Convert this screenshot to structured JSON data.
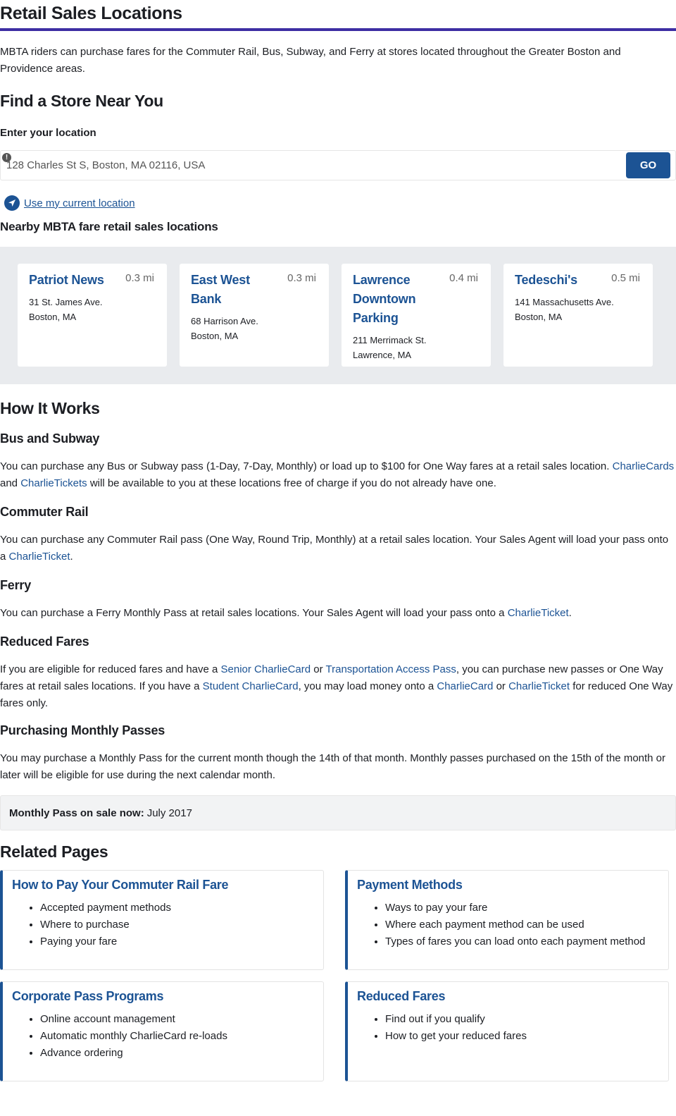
{
  "page": {
    "title": "Retail Sales Locations",
    "intro": "MBTA riders can purchase fares for the Commuter Rail, Bus, Subway, and Ferry at stores located throughout the Greater Boston and Providence areas."
  },
  "finder": {
    "title": "Find a Store Near You",
    "label": "Enter your location",
    "input_value": "128 Charles St S, Boston, MA 02116, USA",
    "go_label": "GO",
    "use_location_label": "Use my current location",
    "nearby_label": "Nearby MBTA fare retail sales locations"
  },
  "stores": [
    {
      "name": "Patriot News",
      "distance": "0.3 mi",
      "street": "31 St. James Ave.",
      "city": "Boston, MA"
    },
    {
      "name": "East West Bank",
      "distance": "0.3 mi",
      "street": "68 Harrison Ave.",
      "city": "Boston, MA"
    },
    {
      "name": "Lawrence Downtown Parking",
      "distance": "0.4 mi",
      "street": "211 Merrimack St.",
      "city": "Lawrence, MA"
    },
    {
      "name": "Tedeschi's",
      "distance": "0.5 mi",
      "street": "141 Massachusetts Ave.",
      "city": "Boston, MA"
    }
  ],
  "how": {
    "title": "How It Works",
    "bus": {
      "heading": "Bus and Subway",
      "t1": "You can purchase any Bus or Subway pass (1-Day, 7-Day, Monthly) or load up to $100 for One Way fares at a retail sales location.",
      "link1": "CharlieCards",
      "t2": " and ",
      "link2": "CharlieTickets",
      "t3": " will be available to you at these locations free of charge if you do not already have one."
    },
    "rail": {
      "heading": "Commuter Rail",
      "t1": "You can purchase any Commuter Rail pass (One Way, Round Trip, Monthly) at a retail sales location. Your Sales Agent will load your pass onto a ",
      "link1": "CharlieTicket",
      "t2": "."
    },
    "ferry": {
      "heading": "Ferry",
      "t1": "You can purchase a Ferry Monthly Pass at retail sales locations. Your Sales Agent will load your pass onto a ",
      "link1": "CharlieTicket",
      "t2": "."
    },
    "reduced": {
      "heading": "Reduced Fares",
      "t1": "If you are eligible for reduced fares and have a ",
      "link1": "Senior CharlieCard",
      "t2": " or ",
      "link2": "Transportation Access Pass",
      "t3": ", you can purchase new passes or One Way fares at retail sales locations. If you have a ",
      "link3": "Student CharlieCard",
      "t4": ", you may load money onto a ",
      "link4": "CharlieCard",
      "t5": " or ",
      "link5": "CharlieTicket",
      "t6": " for reduced One Way fares only."
    },
    "monthly": {
      "heading": "Purchasing Monthly Passes",
      "t1": "You may purchase a Monthly Pass for the current month though the 14th of that month. Monthly passes purchased on the 15th of the month or later will be eligible for use during the next calendar month."
    },
    "sale": {
      "label": "Monthly Pass on sale now:",
      "value": "July 2017"
    }
  },
  "related": {
    "title": "Related Pages",
    "cards": [
      {
        "title": "How to Pay Your Commuter Rail Fare",
        "items": [
          "Accepted payment methods",
          "Where to purchase",
          "Paying your fare"
        ]
      },
      {
        "title": "Payment Methods",
        "items": [
          "Ways to pay your fare",
          "Where each payment method can be used",
          "Types of fares you can load onto each payment method"
        ]
      },
      {
        "title": "Corporate Pass Programs",
        "items": [
          "Online account management",
          "Automatic monthly CharlieCard re-loads",
          "Advance ordering"
        ]
      },
      {
        "title": "Reduced Fares",
        "items": [
          "Find out if you qualify",
          "How to get your reduced fares"
        ]
      }
    ]
  },
  "colors": {
    "brand": "#1c5394",
    "title_rule": "#3d2ea3",
    "store_panel": "#e9ebee"
  },
  "icons": {
    "alert": "alert-icon",
    "location": "location-arrow-icon"
  }
}
